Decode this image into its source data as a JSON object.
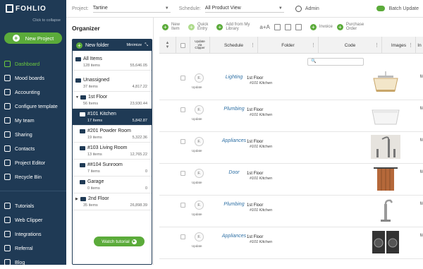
{
  "brand": {
    "name": "FOHLIO",
    "collapse_text": "Click to collapse"
  },
  "new_project_label": "New Project",
  "nav": [
    {
      "label": "Dashboard",
      "icon": "dashboard-icon",
      "active": true
    },
    {
      "label": "Mood boards",
      "icon": "moodboard-icon"
    },
    {
      "label": "Accounting",
      "icon": "accounting-icon"
    },
    {
      "label": "Configure template",
      "icon": "configure-icon"
    },
    {
      "label": "My team",
      "icon": "team-icon"
    },
    {
      "label": "Sharing",
      "icon": "sharing-icon"
    },
    {
      "label": "Contacts",
      "icon": "contacts-icon"
    },
    {
      "label": "Project Editor",
      "icon": "editor-icon"
    },
    {
      "label": "Recycle Bin",
      "icon": "recycle-bin-icon"
    }
  ],
  "nav_bottom": [
    {
      "label": "Tutorials",
      "icon": "tutorials-icon"
    },
    {
      "label": "Web Clipper",
      "icon": "web-clipper-icon"
    },
    {
      "label": "Integrations",
      "icon": "integrations-icon"
    },
    {
      "label": "Referral",
      "icon": "referral-icon"
    },
    {
      "label": "Blog",
      "icon": "blog-icon"
    }
  ],
  "topbar": {
    "project_label": "Project:",
    "project_value": "Tartine",
    "schedule_label": "Schedule:",
    "schedule_value": "All Product View",
    "user": "Admin",
    "batch_update": "Batch Update"
  },
  "organizer": {
    "title": "Organizer",
    "new_folder": "New folder",
    "minimize": "Minimize",
    "watch_tutorial": "Watch tutorial",
    "folders": [
      {
        "name": "All Items",
        "count": "128 items",
        "total": "55,646.05"
      },
      {
        "name": "Unassigned",
        "count": "37 items",
        "total": "4,817.22"
      },
      {
        "name": "1st Floor",
        "count": "56 Items",
        "total": "23,930.44"
      },
      {
        "name": "#101 Kitchen",
        "count": "17 Items",
        "total": "5,842.87"
      },
      {
        "name": "#201 Powder Room",
        "count": "19 items",
        "total": "5,322.36"
      },
      {
        "name": "#103 Living Room",
        "count": "13 items",
        "total": "12,765.22"
      },
      {
        "name": "##104 Sunroom",
        "count": "7 items",
        "total": "0"
      },
      {
        "name": "Garage",
        "count": "0 items",
        "total": "0"
      },
      {
        "name": "2nd Floor",
        "count": "35 items",
        "total": "26,898.39"
      }
    ]
  },
  "toolbar": {
    "new_item": "New\nItem",
    "quick_entry": "Quick\nEntry",
    "add_library": "Add from My\nLibrary",
    "font_size": "a+A",
    "invoice": "Invoice",
    "purchase_order": "Purchase\nOrder"
  },
  "grid": {
    "headers": {
      "update": "Update\nvia\nClipper",
      "schedule": "Schedule",
      "folder": "Folder",
      "code": "Code",
      "images": "Images",
      "last": "In"
    },
    "rows": [
      {
        "schedule": "Lighting",
        "floor": "1st Floor",
        "room": "#101 Kitchen",
        "image": "pendant-light-image",
        "m": "M"
      },
      {
        "schedule": "Plumbing",
        "floor": "1st Floor",
        "room": "#101 Kitchen",
        "image": "sink-image",
        "m": "M"
      },
      {
        "schedule": "Appliances",
        "floor": "1st Floor",
        "room": "#101 Kitchen",
        "image": "faucet-image",
        "m": "M"
      },
      {
        "schedule": "Door",
        "floor": "1st Floor",
        "room": "#101 Kitchen",
        "image": "door-image",
        "m": "M"
      },
      {
        "schedule": "Plumbing",
        "floor": "1st Floor",
        "room": "#101 Kitchen",
        "image": "tap-image",
        "m": "M"
      },
      {
        "schedule": "Appliances",
        "floor": "1st Floor",
        "room": "#101 Kitchen",
        "image": "washer-image",
        "m": "M"
      }
    ],
    "update_label": "Update",
    "badge": "F."
  },
  "colors": {
    "sidebar": "#1f3a55",
    "accent": "#5bab3a",
    "link": "#2d6fa4"
  }
}
